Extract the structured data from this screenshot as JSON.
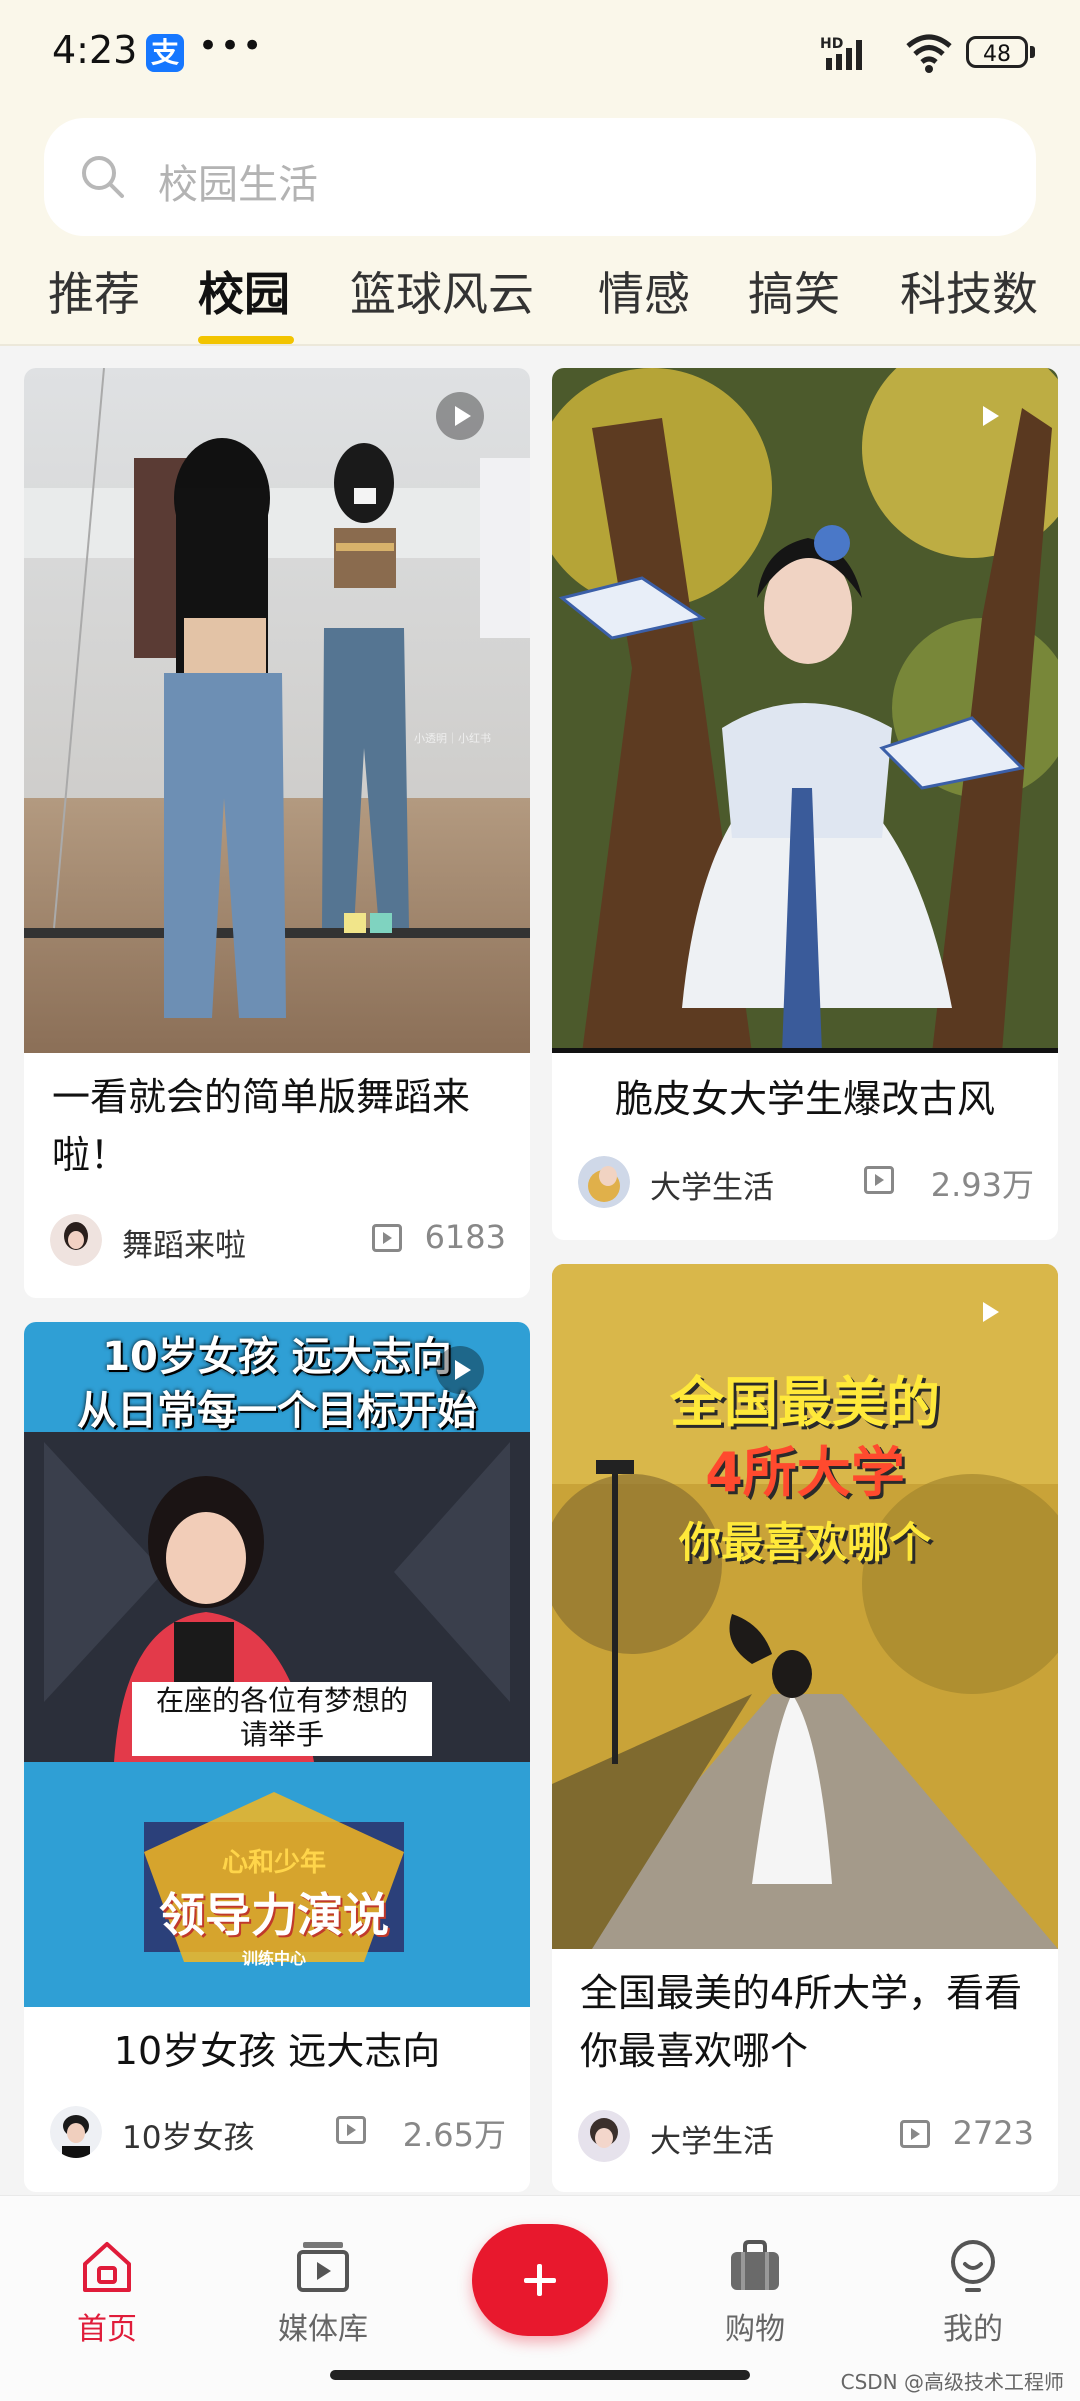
{
  "status_bar": {
    "time": "4:23",
    "app_badge": "支",
    "more": "•••",
    "battery": "48",
    "network": "HD"
  },
  "search": {
    "placeholder": "校园生活"
  },
  "tabs": [
    {
      "label": "推荐",
      "active": false
    },
    {
      "label": "校园",
      "active": true
    },
    {
      "label": "篮球风云",
      "active": false
    },
    {
      "label": "情感",
      "active": false
    },
    {
      "label": "搞笑",
      "active": false
    },
    {
      "label": "科技数",
      "active": false
    }
  ],
  "cards": [
    {
      "title": "一看就会的简单版舞蹈来啦！",
      "author": "舞蹈来啦",
      "views": "6183",
      "thumb_watermark": "小透明｜小红书"
    },
    {
      "title": "脆皮女大学生爆改古风",
      "author": "大学生活",
      "views": "2.93万"
    },
    {
      "title": "10岁女孩 远大志向",
      "author": "10岁女孩",
      "views": "2.65万",
      "overlay": {
        "line1": "10岁女孩 远大志向",
        "line2": "从日常每一个目标开始",
        "caption1": "在座的各位有梦想的",
        "caption2": "请举手",
        "logo1": "心和少年",
        "logo2": "领导力演说",
        "logo3": "训练中心"
      }
    },
    {
      "title": "全国最美的4所大学，看看你最喜欢哪个",
      "author": "大学生活",
      "views": "2723",
      "overlay": {
        "line1": "全国最美的",
        "line2": "4所大学",
        "line3": "你最喜欢哪个"
      }
    }
  ],
  "bottom_nav": {
    "items": [
      {
        "label": "首页",
        "active": true
      },
      {
        "label": "媒体库",
        "active": false
      },
      {
        "label": "购物",
        "active": false
      },
      {
        "label": "我的",
        "active": false
      }
    ]
  },
  "watermark": "CSDN @高级技术工程师",
  "colors": {
    "accent": "#e8182d",
    "tab_indicator": "#f2c400",
    "header_bg": "#faf7ea"
  }
}
